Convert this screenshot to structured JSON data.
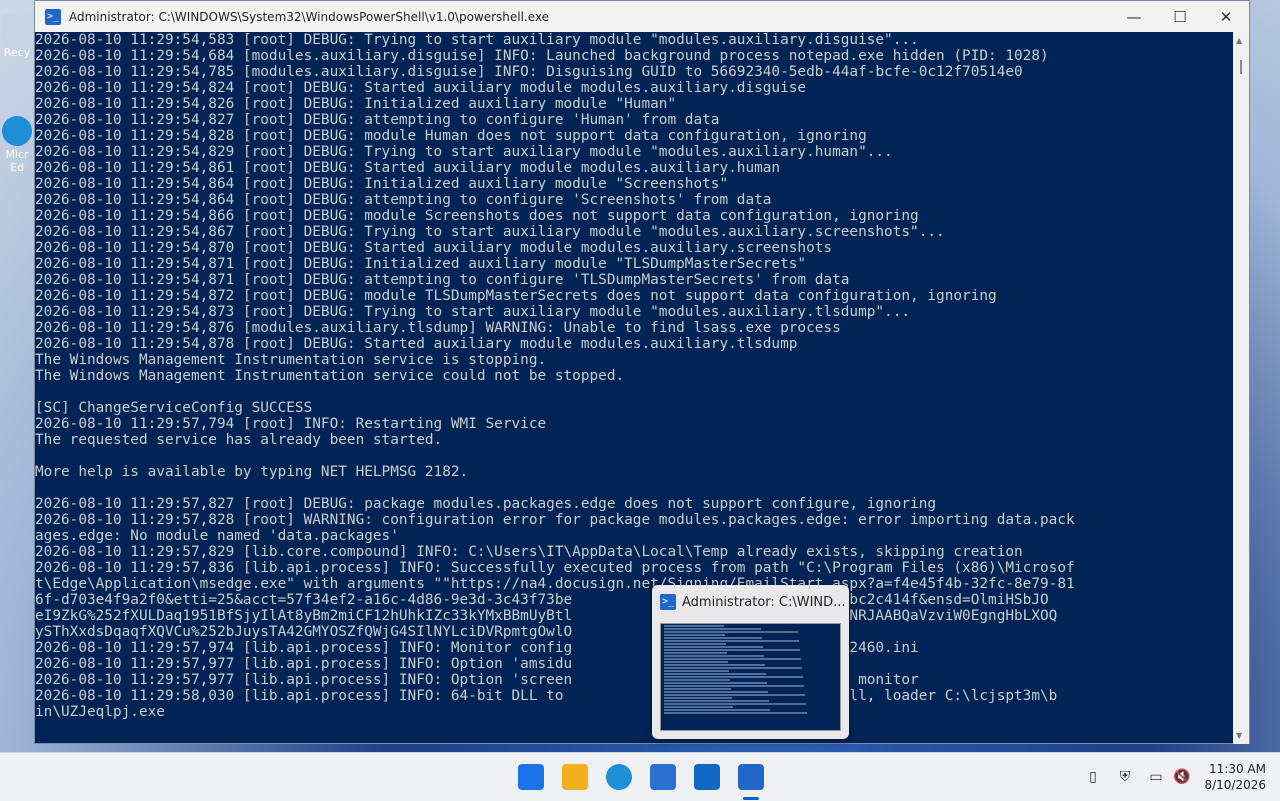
{
  "window": {
    "title": "Administrator: C:\\WINDOWS\\System32\\WindowsPowerShell\\v1.0\\powershell.exe",
    "minimize": "—",
    "maximize": "☐",
    "close": "✕"
  },
  "desktop_icons": [
    {
      "label": "Recy",
      "name": "recycle-bin-icon"
    },
    {
      "label": "Micr\nEd",
      "name": "microsoft-edge-shortcut-icon"
    }
  ],
  "console_lines": [
    "2026-08-10 11:29:54,583 [root] DEBUG: Trying to start auxiliary module \"modules.auxiliary.disguise\"...",
    "2026-08-10 11:29:54,684 [modules.auxiliary.disguise] INFO: Launched background process notepad.exe hidden (PID: 1028)",
    "2026-08-10 11:29:54,785 [modules.auxiliary.disguise] INFO: Disguising GUID to 56692340-5edb-44af-bcfe-0c12f70514e0",
    "2026-08-10 11:29:54,824 [root] DEBUG: Started auxiliary module modules.auxiliary.disguise",
    "2026-08-10 11:29:54,826 [root] DEBUG: Initialized auxiliary module \"Human\"",
    "2026-08-10 11:29:54,827 [root] DEBUG: attempting to configure 'Human' from data",
    "2026-08-10 11:29:54,828 [root] DEBUG: module Human does not support data configuration, ignoring",
    "2026-08-10 11:29:54,829 [root] DEBUG: Trying to start auxiliary module \"modules.auxiliary.human\"...",
    "2026-08-10 11:29:54,861 [root] DEBUG: Started auxiliary module modules.auxiliary.human",
    "2026-08-10 11:29:54,864 [root] DEBUG: Initialized auxiliary module \"Screenshots\"",
    "2026-08-10 11:29:54,864 [root] DEBUG: attempting to configure 'Screenshots' from data",
    "2026-08-10 11:29:54,866 [root] DEBUG: module Screenshots does not support data configuration, ignoring",
    "2026-08-10 11:29:54,867 [root] DEBUG: Trying to start auxiliary module \"modules.auxiliary.screenshots\"...",
    "2026-08-10 11:29:54,870 [root] DEBUG: Started auxiliary module modules.auxiliary.screenshots",
    "2026-08-10 11:29:54,871 [root] DEBUG: Initialized auxiliary module \"TLSDumpMasterSecrets\"",
    "2026-08-10 11:29:54,871 [root] DEBUG: attempting to configure 'TLSDumpMasterSecrets' from data",
    "2026-08-10 11:29:54,872 [root] DEBUG: module TLSDumpMasterSecrets does not support data configuration, ignoring",
    "2026-08-10 11:29:54,873 [root] DEBUG: Trying to start auxiliary module \"modules.auxiliary.tlsdump\"...",
    "2026-08-10 11:29:54,876 [modules.auxiliary.tlsdump] WARNING: Unable to find lsass.exe process",
    "2026-08-10 11:29:54,878 [root] DEBUG: Started auxiliary module modules.auxiliary.tlsdump",
    "The Windows Management Instrumentation service is stopping.",
    "The Windows Management Instrumentation service could not be stopped.",
    "",
    "[SC] ChangeServiceConfig SUCCESS",
    "2026-08-10 11:29:57,794 [root] INFO: Restarting WMI Service",
    "The requested service has already been started.",
    "",
    "More help is available by typing NET HELPMSG 2182.",
    "",
    "2026-08-10 11:29:57,827 [root] DEBUG: package modules.packages.edge does not support configure, ignoring",
    "2026-08-10 11:29:57,828 [root] WARNING: configuration error for package modules.packages.edge: error importing data.pack",
    "ages.edge: No module named 'data.packages'",
    "2026-08-10 11:29:57,829 [lib.core.compound] INFO: C:\\Users\\IT\\AppData\\Local\\Temp already exists, skipping creation",
    "2026-08-10 11:29:57,836 [lib.api.process] INFO: Successfully executed process from path \"C:\\Program Files (x86)\\Microsof",
    "t\\Edge\\Application\\msedge.exe\" with arguments \"\"https://na4.docusign.net/Signing/EmailStart.aspx?a=f4e45f4b-32fc-8e79-81",
    "6f-d703e4f9a2f0&etti=25&acct=57f34ef2-a16c-4d86-9e3d-3c43f73be                 -8ad3-81d5-bd64bc2c414f&ensd=OlmiHSbJO",
    "eI9ZkG%252fXULDaq1951BfSjyIlAt8yBm2miCF12hUhkIZc33kYMxBBmUyBtl                 dCF4eDtZL1mFdJ1NRJAABQaVzviW0EgngHbLXOQ",
    "ySThXxdsDqaqfXQVCu%252bJuysTA42GMYOSZfQWjG4SIlNYLciDVRpmtgOwlO                 d 2460",
    "2026-08-10 11:29:57,974 [lib.api.process] INFO: Monitor config                 :\\lcjspt3m\\dll\\2460.ini",
    "2026-08-10 11:29:57,977 [lib.api.process] INFO: Option 'amsidu                 sent to monitor",
    "2026-08-10 11:29:57,977 [lib.api.process] INFO: Option 'screen                 e 'yes' sent to monitor",
    "2026-08-10 11:29:58,030 [lib.api.process] INFO: 64-bit DLL to                  3m\\dll\\TXoAaM.dll, loader C:\\lcjspt3m\\b",
    "in\\UZJeqlpj.exe"
  ],
  "thumbnail": {
    "title": "Administrator: C:\\WIND..."
  },
  "taskbar": {
    "apps": [
      {
        "name": "start-button-icon",
        "color": "#1a73e8"
      },
      {
        "name": "file-explorer-icon",
        "color": "#f2b01e"
      },
      {
        "name": "edge-browser-icon",
        "color": "#1e8fd6"
      },
      {
        "name": "microsoft-store-icon",
        "color": "#2b6fcf"
      },
      {
        "name": "outlook-icon",
        "color": "#1067c4"
      },
      {
        "name": "powershell-icon",
        "color": "#1e66c9"
      }
    ],
    "time": "11:30 AM",
    "date": "8/10/2026"
  },
  "colors": {
    "console_bg": "#012456",
    "console_fg": "#cccccc",
    "accent": "#0a5fd1"
  }
}
